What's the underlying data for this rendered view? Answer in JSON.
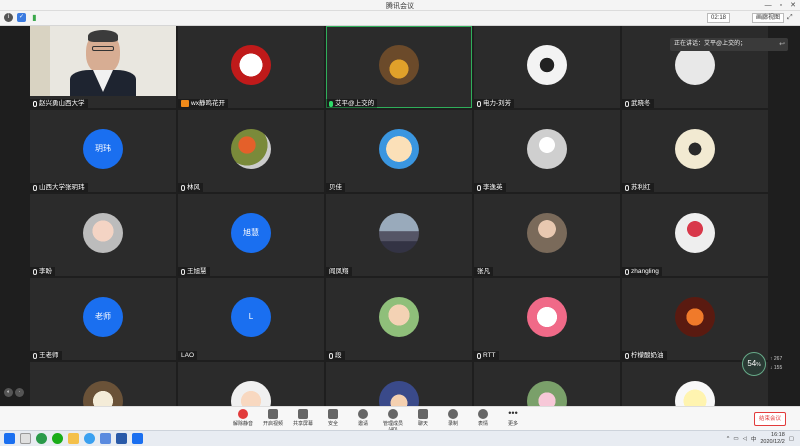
{
  "window": {
    "title": "腾讯会议",
    "controls": [
      "—",
      "▫",
      "✕"
    ]
  },
  "topbar": {
    "icons": [
      "info-icon",
      "shield-icon",
      "signal-icon"
    ],
    "timer": "02:18",
    "view_button": "画廊视图",
    "fullscreen_icon": "⤢"
  },
  "participants": [
    {
      "name": "赵兴勇山西大学",
      "type": "video",
      "mic": "unmuted"
    },
    {
      "name": "wx静鸣花开",
      "type": "avatar",
      "avatar": "red-seal",
      "badge": "wx"
    },
    {
      "name": "艾平@上交的",
      "type": "avatar",
      "avatar": "cake",
      "mic": "speaking",
      "active": true
    },
    {
      "name": "电力-刘芳",
      "type": "avatar",
      "avatar": "calligraphy"
    },
    {
      "name": "武晓冬",
      "type": "avatar",
      "avatar": "blank-white"
    },
    {
      "name": "山西大学张玥玮",
      "type": "text",
      "initials": "玥玮"
    },
    {
      "name": "林风",
      "type": "avatar",
      "avatar": "flowers"
    },
    {
      "name": "贝佳",
      "type": "avatar",
      "avatar": "cartoon",
      "no_mic": true
    },
    {
      "name": "李逸英",
      "type": "avatar",
      "avatar": "default"
    },
    {
      "name": "苏利红",
      "type": "avatar",
      "avatar": "calligraphy-2"
    },
    {
      "name": "李盼",
      "type": "avatar",
      "avatar": "baby"
    },
    {
      "name": "王旭慧",
      "type": "text",
      "initials": "旭慧"
    },
    {
      "name": "阎凤翔",
      "type": "avatar",
      "avatar": "city",
      "no_mic": true
    },
    {
      "name": "张凡",
      "type": "avatar",
      "avatar": "girl",
      "no_mic": true
    },
    {
      "name": "zhangling",
      "type": "avatar",
      "avatar": "bouquet"
    },
    {
      "name": "王老师",
      "type": "text",
      "initials": "老师"
    },
    {
      "name": "LAO",
      "type": "text",
      "initials": "L",
      "no_mic": true
    },
    {
      "name": "段",
      "type": "avatar",
      "avatar": "toddler"
    },
    {
      "name": "RTT",
      "type": "avatar",
      "avatar": "hello-kitty"
    },
    {
      "name": "柠檬酸奶油",
      "type": "avatar",
      "avatar": "fire"
    },
    {
      "name": "",
      "type": "avatar",
      "avatar": "panda"
    },
    {
      "name": "",
      "type": "avatar",
      "avatar": "cartoon-girl"
    },
    {
      "name": "",
      "type": "avatar",
      "avatar": "anime"
    },
    {
      "name": "",
      "type": "avatar",
      "avatar": "magnolia"
    },
    {
      "name": "",
      "type": "avatar",
      "avatar": "chick"
    }
  ],
  "chat_bubble": {
    "text": "正在讲话：艾平@上交的；",
    "reply_icon": "↩"
  },
  "network_stats": {
    "value": "54",
    "unit": "%",
    "up": "267",
    "down": "155"
  },
  "toolbar": {
    "items": [
      {
        "label": "解除静音",
        "icon": "mic-muted-icon"
      },
      {
        "label": "开启视频",
        "icon": "camera-icon"
      },
      {
        "label": "共享屏幕",
        "icon": "share-screen-icon"
      },
      {
        "label": "安全",
        "icon": "shield-icon"
      },
      {
        "label": "邀请",
        "icon": "invite-icon"
      },
      {
        "label": "管理成员(40)",
        "icon": "members-icon"
      },
      {
        "label": "聊天",
        "icon": "chat-icon"
      },
      {
        "label": "录制",
        "icon": "record-icon"
      },
      {
        "label": "表情",
        "icon": "emoji-icon"
      },
      {
        "label": "更多",
        "icon": "more-icon"
      }
    ],
    "leave": "结束会议"
  },
  "taskbar": {
    "apps": [
      "windows-icon",
      "browser-icon",
      "edge-icon",
      "wechat-icon",
      "folder-icon",
      "qq-icon",
      "app-icon",
      "word-icon",
      "meeting-icon"
    ],
    "time": "16:18",
    "date": "2020/12/2",
    "ime": "中"
  }
}
